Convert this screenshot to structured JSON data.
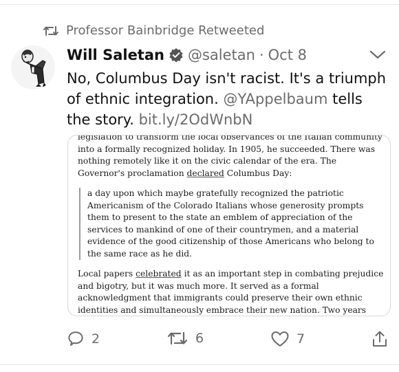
{
  "retweet": {
    "icon": "retweet-icon",
    "label": "Professor Bainbridge Retweeted"
  },
  "tweet": {
    "avatar_icon": "caricature-avatar",
    "name": "Will Saletan",
    "verified_icon": "verified-badge-icon",
    "handle": "@saletan",
    "separator": "·",
    "date": "Oct 8",
    "menu_icon": "chevron-down-icon",
    "text_part1": "No, Columbus Day isn't racist. It's a triumph of ethnic integration.",
    "mention": "@YAppelbaum",
    "text_part2": "tells the story.",
    "link": "bit.ly/2OdWnbN"
  },
  "card": {
    "p1_a": "legislation to transform the local observances of the Italian community into a formally recognized holiday. In 1905, he succeeded. There was nothing remotely like it on the civic calendar of the era. The Governor's proclamation",
    "p1_link": "declared",
    "p1_b": "Columbus Day:",
    "quote": "a day upon which maybe gratefully recognized the patriotic Americanism of the Colorado Italians whose generosity prompts them to present to the state an emblem of appreciation of the services to mankind of one of their countrymen, and a material evidence of the good citizenship of those Americans who belong to the same race as he did.",
    "p2_a": "Local papers",
    "p2_link": "celebrated",
    "p2_b": "it as an important step in combating prejudice and bigotry, but it was much more. It served as a formal acknowledgment that immigrants could preserve their own ethnic identities and simultaneously embrace their new nation. Two years later, it became a statutory holiday. Over the ensuing decades"
  },
  "actions": {
    "reply": {
      "icon": "reply-icon",
      "count": "2"
    },
    "retweet": {
      "icon": "retweet-icon",
      "count": "6"
    },
    "like": {
      "icon": "heart-icon",
      "count": "7"
    },
    "share": {
      "icon": "share-icon"
    }
  },
  "colors": {
    "secondary_text": "#6b6b6b",
    "primary_text": "#111111",
    "border": "#d6d6d6"
  }
}
